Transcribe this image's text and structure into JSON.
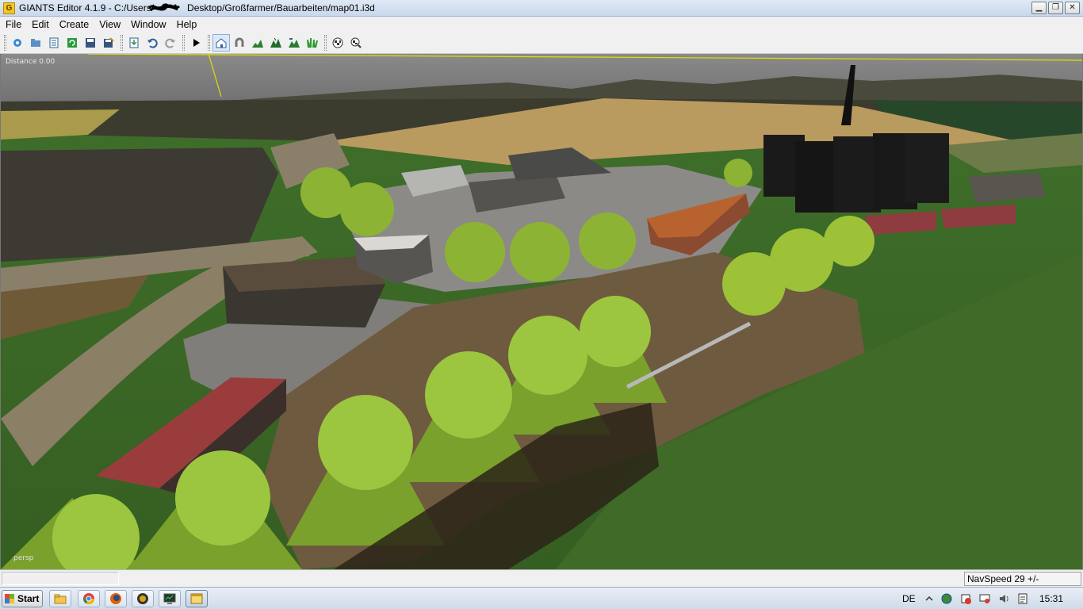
{
  "window": {
    "title": "GIANTS Editor 4.1.9 - C:/Users/",
    "title_path_tail": "Desktop/Großfarmer/Bauarbeiten/map01.i3d",
    "app_icon_letter": "G",
    "minimize": "▁",
    "maximize": "❐",
    "close": "✕"
  },
  "menu": {
    "items": [
      "File",
      "Edit",
      "Create",
      "View",
      "Window",
      "Help"
    ]
  },
  "toolbar": {
    "buttons": [
      "new-icon",
      "open-icon",
      "list-icon",
      "refresh-icon",
      "save-icon",
      "save-as-icon",
      "import-icon",
      "undo-icon",
      "redo-icon",
      "play-icon",
      "home-icon",
      "magnet-icon",
      "terrain-sculpt-icon",
      "terrain-paint-icon",
      "foliage-paint-icon",
      "grass-paint-icon",
      "checker-icon",
      "checker-search-icon"
    ],
    "active_button": "home-icon"
  },
  "viewport": {
    "distance_label": "Distance 0.00",
    "camera_label": "persp"
  },
  "status": {
    "navspeed": "NavSpeed 29 +/-"
  },
  "taskbar": {
    "start_label": "Start",
    "apps": [
      "explorer",
      "chrome",
      "firefox",
      "farming-simulator",
      "network-monitor",
      "giants-editor"
    ],
    "language": "DE",
    "time": "15:31"
  },
  "colors": {
    "sky": "#7a7a7a",
    "grass": "#3d6b2a",
    "field_wheat": "#b99a5f",
    "roof_red": "#9b3c3c"
  }
}
